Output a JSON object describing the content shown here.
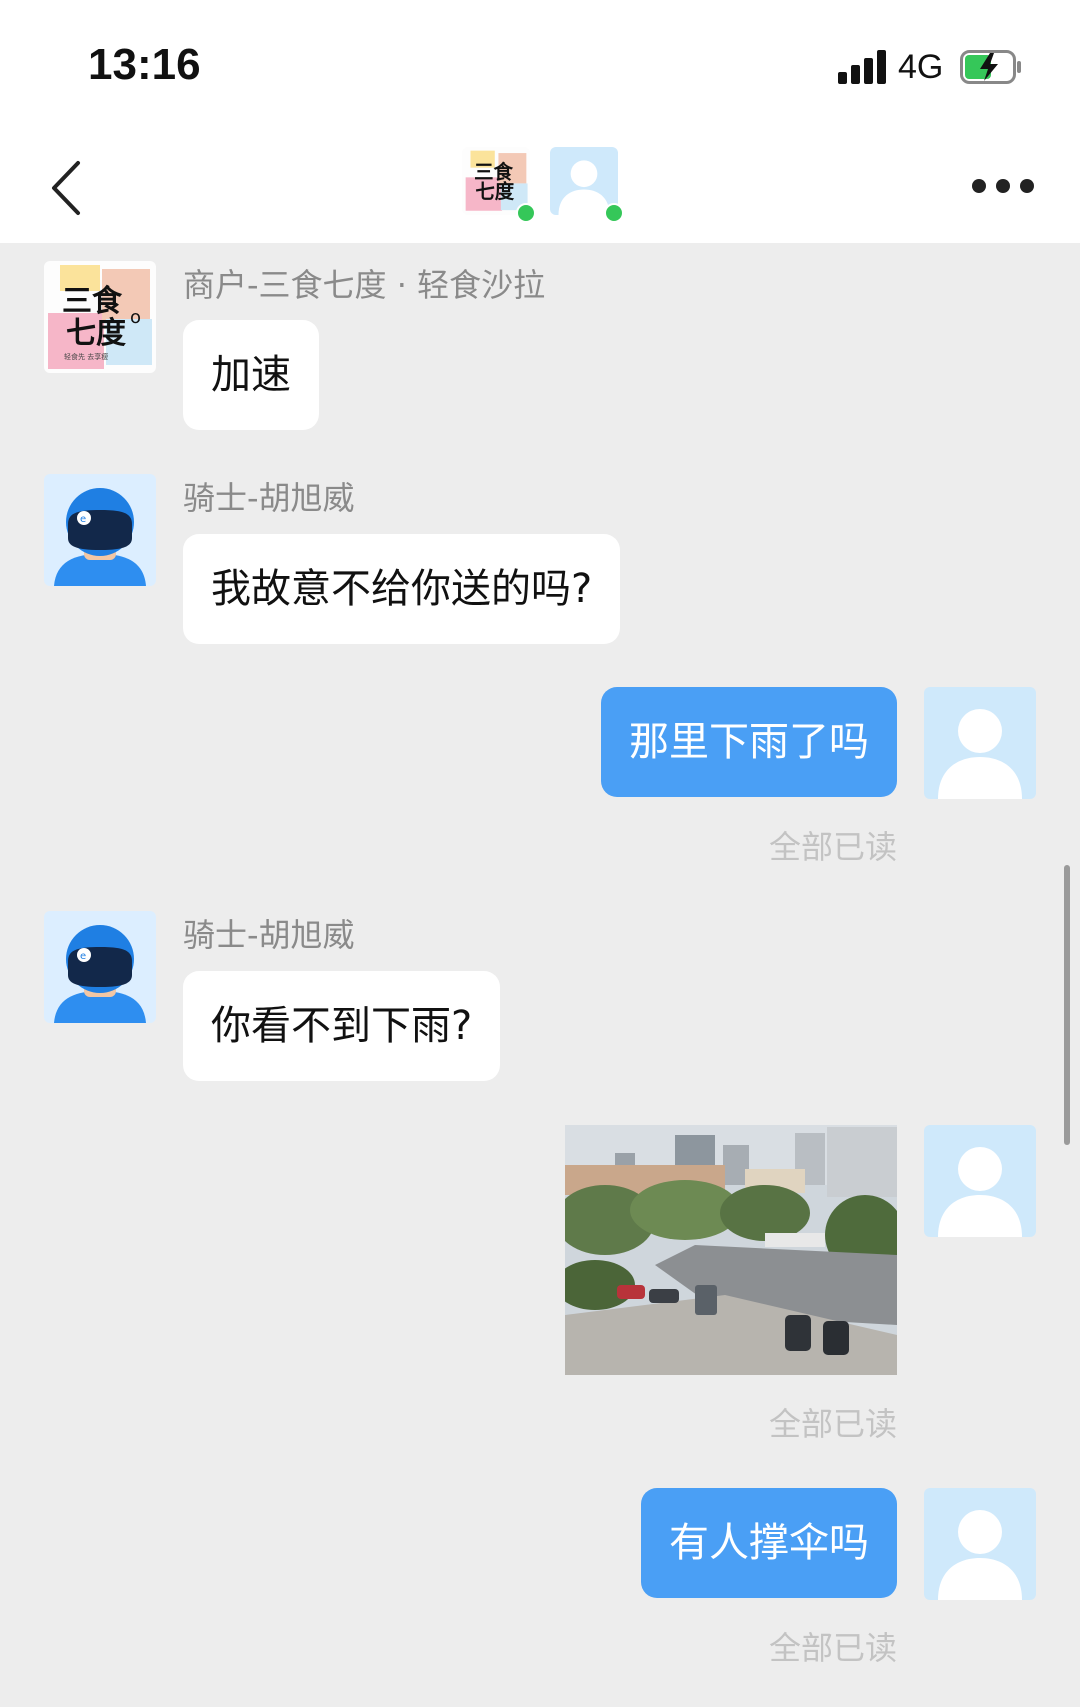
{
  "status_bar": {
    "time": "13:16",
    "network": "4G"
  },
  "chat": {
    "messages": [
      {
        "sender": "商户-三食七度 · 轻食沙拉",
        "text": "加速"
      },
      {
        "sender": "骑士-胡旭威",
        "text": "我故意不给你送的吗?"
      },
      {
        "text": "那里下雨了吗",
        "read": "全部已读"
      },
      {
        "sender": "骑士-胡旭威",
        "text": "你看不到下雨?"
      },
      {
        "read": "全部已读"
      },
      {
        "text": "有人撑伞吗",
        "read": "全部已读"
      }
    ]
  },
  "merchant_logo": {
    "line1": "三食",
    "line2": "七度",
    "small": "轻食先 去享瘦"
  },
  "colors": {
    "accent": "#4a9ff5",
    "online": "#35c759",
    "background": "#ededed"
  },
  "icons": [
    "back-icon",
    "more-icon",
    "signal-icon",
    "battery-icon",
    "rider-helmet-icon",
    "default-user-icon"
  ]
}
